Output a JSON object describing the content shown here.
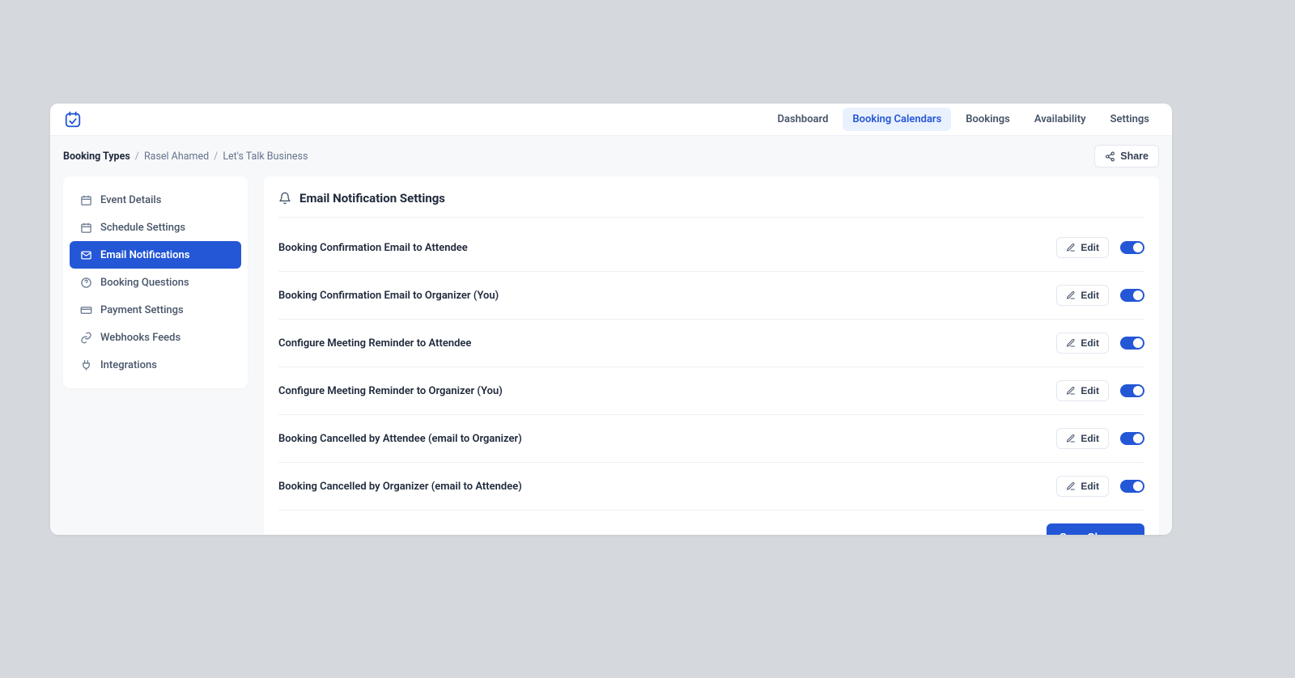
{
  "topnav": {
    "items": [
      {
        "label": "Dashboard",
        "active": false
      },
      {
        "label": "Booking Calendars",
        "active": true
      },
      {
        "label": "Bookings",
        "active": false
      },
      {
        "label": "Availability",
        "active": false
      },
      {
        "label": "Settings",
        "active": false
      }
    ]
  },
  "breadcrumb": {
    "root": "Booking Types",
    "mid": "Rasel Ahamed",
    "leaf": "Let's Talk Business"
  },
  "share_label": "Share",
  "sidebar": {
    "items": [
      {
        "label": "Event Details",
        "icon": "calendar-icon"
      },
      {
        "label": "Schedule Settings",
        "icon": "schedule-icon"
      },
      {
        "label": "Email Notifications",
        "icon": "mail-icon"
      },
      {
        "label": "Booking Questions",
        "icon": "question-icon"
      },
      {
        "label": "Payment Settings",
        "icon": "payment-icon"
      },
      {
        "label": "Webhooks Feeds",
        "icon": "link-icon"
      },
      {
        "label": "Integrations",
        "icon": "plug-icon"
      }
    ],
    "active_index": 2
  },
  "panel": {
    "title": "Email Notification Settings",
    "edit_label": "Edit",
    "rows": [
      {
        "label": "Booking Confirmation Email to Attendee",
        "enabled": true
      },
      {
        "label": "Booking Confirmation Email to Organizer (You)",
        "enabled": true
      },
      {
        "label": "Configure Meeting Reminder to Attendee",
        "enabled": true
      },
      {
        "label": "Configure Meeting Reminder to Organizer (You)",
        "enabled": true
      },
      {
        "label": "Booking Cancelled by Attendee (email to Organizer)",
        "enabled": true
      },
      {
        "label": "Booking Cancelled by Organizer (email to Attendee)",
        "enabled": true
      }
    ],
    "save_label": "Save Changes"
  },
  "colors": {
    "primary": "#2457d6",
    "page_bg": "#d5d9dd",
    "panel_bg": "#ffffff",
    "muted_bg": "#f7f8fa"
  }
}
